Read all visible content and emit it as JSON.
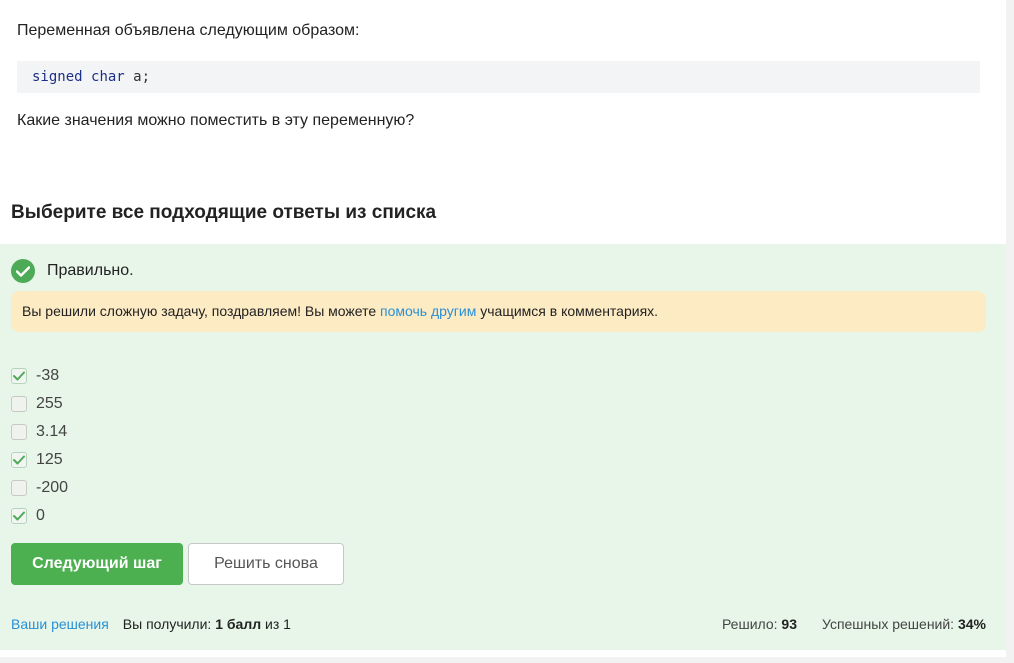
{
  "question": {
    "intro": "Переменная объявлена следующим образом:",
    "code": {
      "kw1": "signed",
      "kw2": "char",
      "rest": "a;"
    },
    "prompt": "Какие значения можно поместить в эту переменную?"
  },
  "section_title": "Выберите все подходящие ответы из списка",
  "result": {
    "status": "Правильно.",
    "status_icon": "check-circle-icon",
    "congrats_before": "Вы решили сложную задачу, поздравляем! Вы можете ",
    "congrats_link": "помочь другим",
    "congrats_after": " учащимся в комментариях."
  },
  "options": [
    {
      "label": "-38",
      "checked": true
    },
    {
      "label": "255",
      "checked": false
    },
    {
      "label": "3.14",
      "checked": false
    },
    {
      "label": "125",
      "checked": true
    },
    {
      "label": "-200",
      "checked": false
    },
    {
      "label": "0",
      "checked": true
    }
  ],
  "buttons": {
    "next": "Следующий шаг",
    "retry": "Решить снова"
  },
  "footer": {
    "my_solutions": "Ваши решения",
    "got_label": "Вы получили: ",
    "got_value": "1 балл",
    "got_of": " из 1",
    "solved_label": "Решило: ",
    "solved_value": "93",
    "success_label": "Успешных решений: ",
    "success_value": "34%"
  },
  "colors": {
    "panel_bg": "#e7f6e8",
    "accent_green": "#4caf50",
    "link_blue": "#2a8fd6",
    "notice_bg": "#fdebc4"
  }
}
